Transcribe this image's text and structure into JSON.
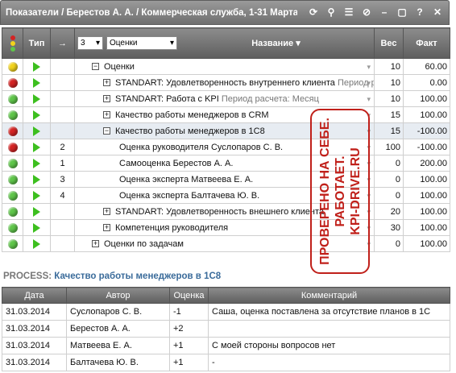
{
  "window": {
    "title": "Показатели / Берестов А. А. / Коммерческая служба, 1-31 Марта",
    "icons": [
      "refresh-icon",
      "search-icon",
      "list-icon",
      "tag-icon",
      "minimize-icon",
      "restore-icon",
      "help-icon",
      "close-icon"
    ]
  },
  "grid": {
    "headers": {
      "type": "Тип",
      "arrow": "→",
      "level": "3",
      "view": "Оценки",
      "name": "Название",
      "weight": "Вес",
      "fact": "Факт"
    },
    "rows": [
      {
        "status": "yellow",
        "num": "",
        "indent": 1,
        "tree": "⊟",
        "name": "Оценки",
        "period": "",
        "weight": "10",
        "fact": "60.00",
        "highlight": false
      },
      {
        "status": "red",
        "num": "",
        "indent": 2,
        "tree": "⊞",
        "name": "STANDART: Удовлетворенность внутреннего клиента",
        "period": "Период расчета: Месяц",
        "weight": "10",
        "fact": "0.00",
        "highlight": false
      },
      {
        "status": "green",
        "num": "",
        "indent": 2,
        "tree": "⊞",
        "name": "STANDART: Работа с KPI",
        "period": "Период расчета: Месяц",
        "weight": "10",
        "fact": "100.00",
        "highlight": false
      },
      {
        "status": "green",
        "num": "",
        "indent": 2,
        "tree": "⊞",
        "name": "Качество работы менеджеров в CRM",
        "period": "",
        "weight": "15",
        "fact": "100.00",
        "highlight": false
      },
      {
        "status": "red",
        "num": "",
        "indent": 2,
        "tree": "⊟",
        "name": "Качество работы менеджеров в 1C8",
        "period": "",
        "weight": "15",
        "fact": "-100.00",
        "highlight": true
      },
      {
        "status": "red",
        "num": "2",
        "indent": 3,
        "tree": "",
        "name": "Оценка руководителя Суслопаров С. В.",
        "period": "",
        "weight": "100",
        "fact": "-100.00",
        "highlight": false
      },
      {
        "status": "green",
        "num": "1",
        "indent": 3,
        "tree": "",
        "name": "Самооценка Берестов А. А.",
        "period": "",
        "weight": "0",
        "fact": "200.00",
        "highlight": false
      },
      {
        "status": "green",
        "num": "3",
        "indent": 3,
        "tree": "",
        "name": "Оценка эксперта Матвеева Е. А.",
        "period": "",
        "weight": "0",
        "fact": "100.00",
        "highlight": false
      },
      {
        "status": "green",
        "num": "4",
        "indent": 3,
        "tree": "",
        "name": "Оценка эксперта Балтачева Ю. В.",
        "period": "",
        "weight": "0",
        "fact": "100.00",
        "highlight": false
      },
      {
        "status": "green",
        "num": "",
        "indent": 2,
        "tree": "⊞",
        "name": "STANDART: Удовлетворенность внешнего клиента",
        "period": "",
        "weight": "20",
        "fact": "100.00",
        "highlight": false
      },
      {
        "status": "green",
        "num": "",
        "indent": 2,
        "tree": "⊞",
        "name": "Компетенция руководителя",
        "period": "",
        "weight": "30",
        "fact": "100.00",
        "highlight": false
      },
      {
        "status": "green",
        "num": "",
        "indent": 1,
        "tree": "⊞",
        "name": "Оценки по задачам",
        "period": "",
        "weight": "0",
        "fact": "100.00",
        "highlight": false
      }
    ]
  },
  "stamp": {
    "line1": "ПРОВЕРЕНО НА СЕБЕ.",
    "line2": "РАБОТАЕТ.",
    "line3": "KPI-DRIVE.RU",
    "color": "#c0201a"
  },
  "process": {
    "label": "PROCESS:",
    "value": "Качество работы менеджеров в 1C8",
    "headers": {
      "date": "Дата",
      "author": "Автор",
      "score": "Оценка",
      "comment": "Комментарий"
    },
    "rows": [
      {
        "date": "31.03.2014",
        "author": "Суслопаров С. В.",
        "score": "-1",
        "comment": "Саша, оценка поставлена за отсутствие планов в 1С"
      },
      {
        "date": "31.03.2014",
        "author": "Берестов А. А.",
        "score": "+2",
        "comment": ""
      },
      {
        "date": "31.03.2014",
        "author": "Матвеева Е. А.",
        "score": "+1",
        "comment": "С моей стороны вопросов нет"
      },
      {
        "date": "31.03.2014",
        "author": "Балтачева Ю. В.",
        "score": "+1",
        "comment": "-"
      }
    ]
  }
}
